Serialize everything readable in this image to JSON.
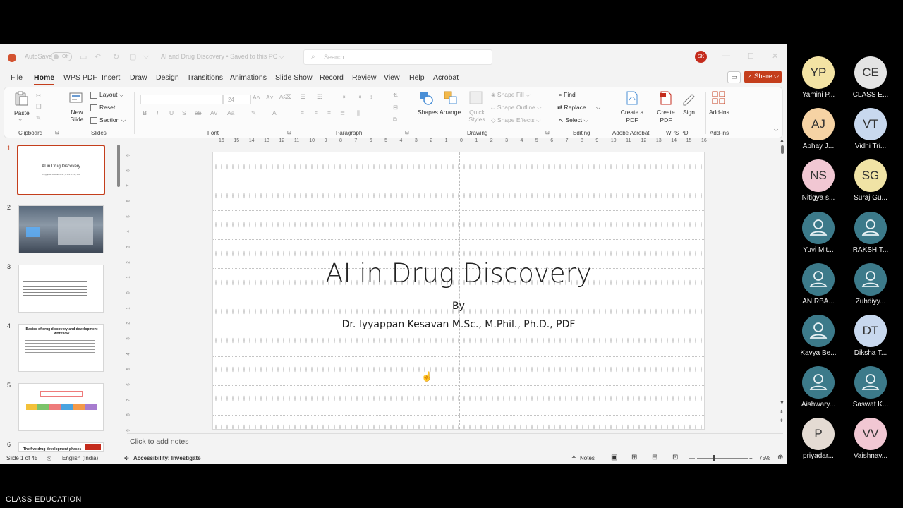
{
  "titlebar": {
    "autosave_label": "AutoSave",
    "autosave_state": "Off",
    "document_name": "AI and Drug Discovery • Saved to this PC ⌵",
    "search_placeholder": "Search",
    "user_initials": "SK"
  },
  "tabs": [
    "File",
    "Home",
    "WPS PDF",
    "Insert",
    "Draw",
    "Design",
    "Transitions",
    "Animations",
    "Slide Show",
    "Record",
    "Review",
    "View",
    "Help",
    "Acrobat"
  ],
  "share_label": "Share",
  "ribbon": {
    "clipboard": {
      "paste": "Paste",
      "group": "Clipboard"
    },
    "slides": {
      "new_slide": "New Slide",
      "layout": "Layout",
      "reset": "Reset",
      "section": "Section",
      "group": "Slides"
    },
    "font": {
      "size": "24",
      "group": "Font"
    },
    "paragraph": {
      "group": "Paragraph"
    },
    "drawing": {
      "shapes": "Shapes",
      "arrange": "Arrange",
      "quick_styles": "Quick Styles",
      "shape_fill": "Shape Fill",
      "shape_outline": "Shape Outline",
      "shape_effects": "Shape Effects",
      "group": "Drawing"
    },
    "editing": {
      "find": "Find",
      "replace": "Replace",
      "select": "Select",
      "group": "Editing"
    },
    "adobe": {
      "create_pdf": "Create a PDF",
      "group": "Adobe Acrobat"
    },
    "wps": {
      "create_pdf": "Create PDF",
      "sign": "Sign",
      "group": "WPS PDF"
    },
    "addins": {
      "label": "Add-ins",
      "group": "Add-ins"
    }
  },
  "hruler_ticks": [
    "16",
    "15",
    "14",
    "13",
    "12",
    "11",
    "10",
    "9",
    "8",
    "7",
    "6",
    "5",
    "4",
    "3",
    "2",
    "1",
    "0",
    "1",
    "2",
    "3",
    "4",
    "5",
    "6",
    "7",
    "8",
    "9",
    "10",
    "11",
    "12",
    "13",
    "14",
    "15",
    "16"
  ],
  "vruler_ticks": [
    "9",
    "8",
    "7",
    "6",
    "5",
    "4",
    "3",
    "2",
    "1",
    "0",
    "1",
    "2",
    "3",
    "4",
    "5",
    "6",
    "7",
    "8",
    "9"
  ],
  "thumbnails": [
    {
      "num": "1",
      "title": "AI in Drug Discovery",
      "sub": "Dr. Iyyappan Kesavan M.Sc., M.Phil., Ph.D., PDF"
    },
    {
      "num": "2"
    },
    {
      "num": "3"
    },
    {
      "num": "4",
      "title": "Basics of drug discovery and development workflow"
    },
    {
      "num": "5"
    },
    {
      "num": "6",
      "title": "The five drug development phases"
    }
  ],
  "slide": {
    "title": "AI in Drug Discovery",
    "by": "By",
    "author": "Dr. Iyyappan Kesavan M.Sc., M.Phil., Ph.D., PDF"
  },
  "notes_placeholder": "Click to add notes",
  "status": {
    "slide_of": "Slide 1 of 45",
    "language": "English (India)",
    "accessibility": "Accessibility: Investigate",
    "notes": "Notes",
    "zoom": "75%"
  },
  "participants": [
    {
      "initials": "YP",
      "name": "Yamini P...",
      "color": "#f3e3a4",
      "teal": false
    },
    {
      "initials": "CE",
      "name": "CLASS  E...",
      "color": "#e4e4e4",
      "teal": false
    },
    {
      "initials": "AJ",
      "name": "Abhay J...",
      "color": "#f6d3a4",
      "teal": false
    },
    {
      "initials": "VT",
      "name": "Vidhi Tri...",
      "color": "#c8d8ee",
      "teal": false
    },
    {
      "initials": "NS",
      "name": "Nitigya s...",
      "color": "#f1c7d3",
      "teal": false
    },
    {
      "initials": "SG",
      "name": "Suraj Gu...",
      "color": "#f0e3a5",
      "teal": false
    },
    {
      "initials": "",
      "name": "Yuvi Mit...",
      "color": "#3c7a8a",
      "teal": true
    },
    {
      "initials": "",
      "name": "RAKSHIT...",
      "color": "#3c7a8a",
      "teal": true
    },
    {
      "initials": "",
      "name": "ANIRBA...",
      "color": "#3c7a8a",
      "teal": true
    },
    {
      "initials": "",
      "name": "Zuhdiyy...",
      "color": "#3c7a8a",
      "teal": true
    },
    {
      "initials": "",
      "name": "Kavya Be...",
      "color": "#3c7a8a",
      "teal": true
    },
    {
      "initials": "DT",
      "name": "Diksha T...",
      "color": "#c8d8ee",
      "teal": false
    },
    {
      "initials": "",
      "name": "Aishwary...",
      "color": "#3c7a8a",
      "teal": true
    },
    {
      "initials": "",
      "name": "Saswat K...",
      "color": "#3c7a8a",
      "teal": true
    },
    {
      "initials": "P",
      "name": "priyadar...",
      "color": "#e4dbd3",
      "teal": false
    },
    {
      "initials": "VV",
      "name": "Vaishnav...",
      "color": "#f1c7d3",
      "teal": false
    }
  ],
  "bottom_label": "CLASS  EDUCATION",
  "colors": {
    "accent": "#c43e1c",
    "participant_teal": "#3c7a8a"
  }
}
